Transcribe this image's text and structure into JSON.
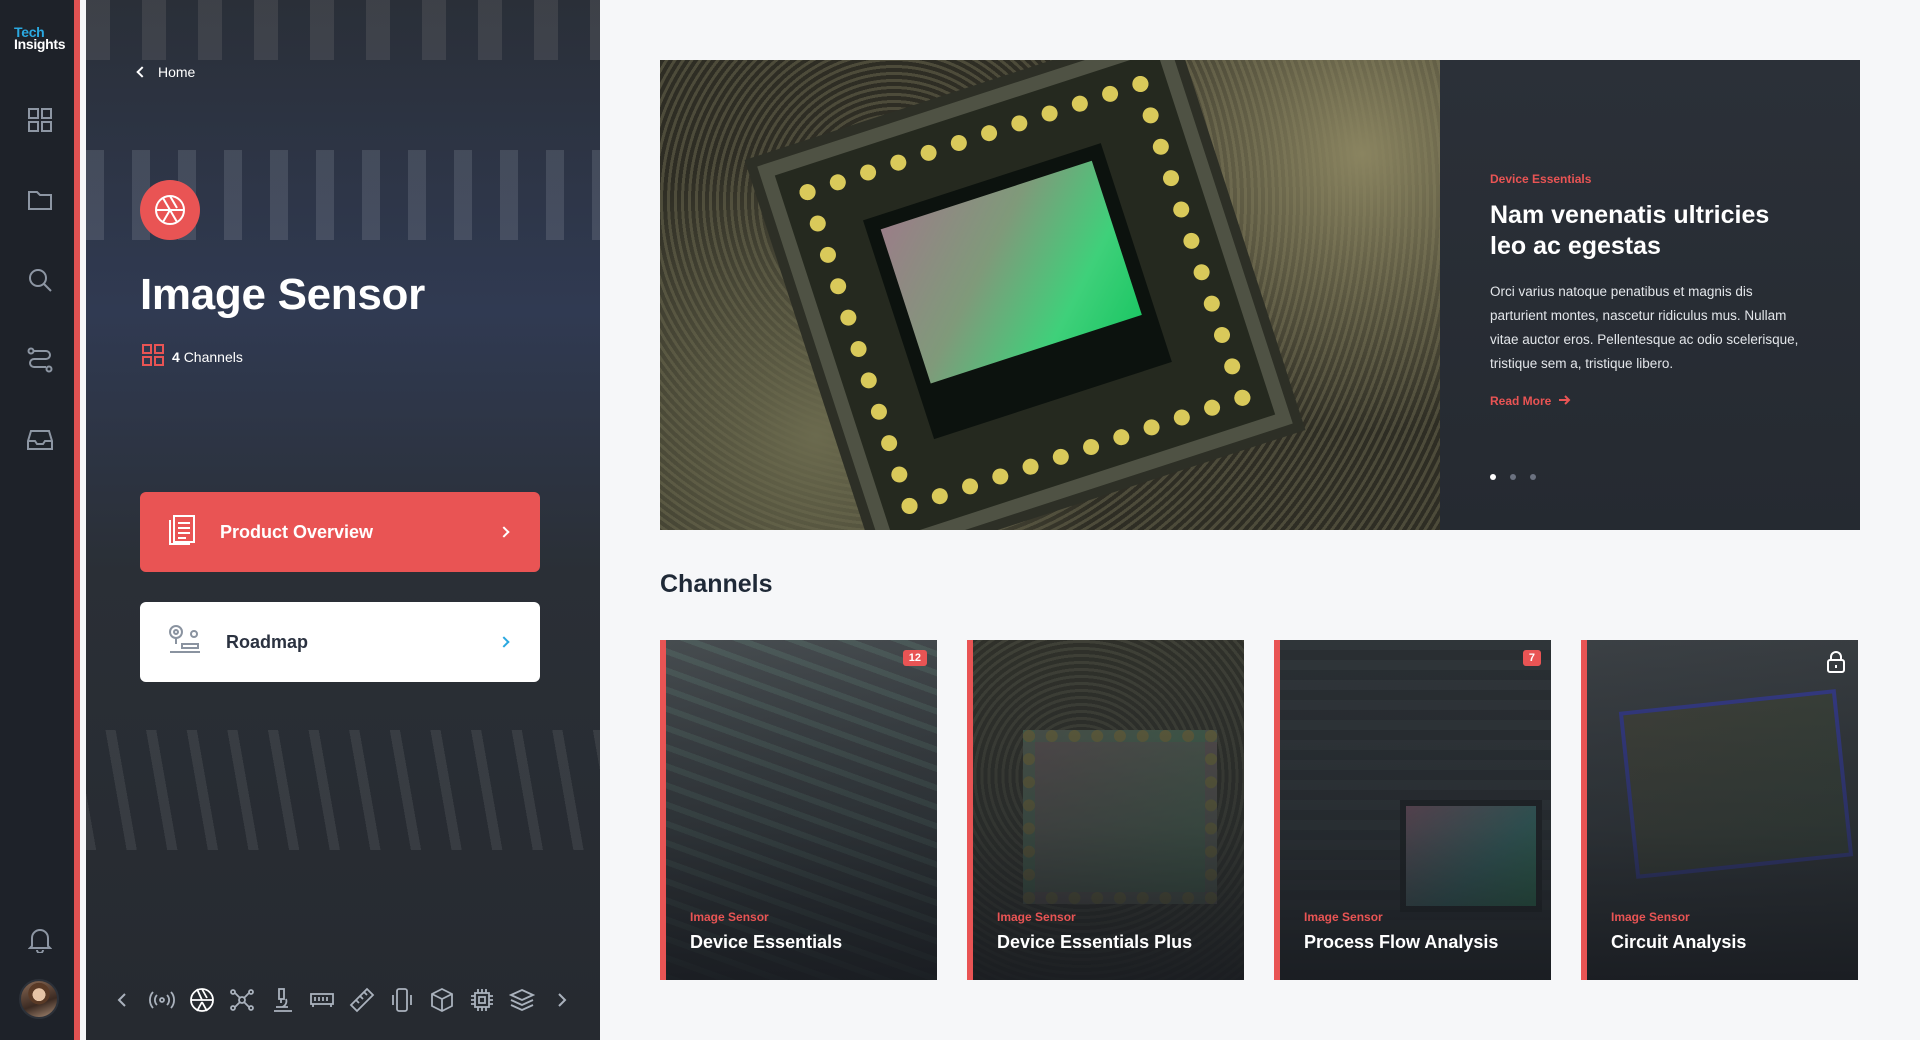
{
  "app": {
    "logo_top": "Tech",
    "logo_bottom": "Insights"
  },
  "rail": {
    "items": [
      {
        "icon": "dashboard-grid-icon"
      },
      {
        "icon": "folder-icon"
      },
      {
        "icon": "search-icon"
      },
      {
        "icon": "route-icon"
      },
      {
        "icon": "inbox-icon"
      }
    ],
    "notifications_icon": "bell-icon",
    "avatar": "user-avatar"
  },
  "panel": {
    "back_label": "Home",
    "product_icon": "aperture-icon",
    "product_title": "Image Sensor",
    "channels_count": "4",
    "channels_label": "Channels",
    "nav": [
      {
        "label": "Product Overview",
        "icon": "document-icon",
        "active": true
      },
      {
        "label": "Roadmap",
        "icon": "roadmap-icon",
        "active": false
      }
    ],
    "bottom_icons": [
      "broadcast-icon",
      "aperture-icon",
      "network-icon",
      "microscope-icon",
      "memory-icon",
      "ruler-icon",
      "phone-vibrate-icon",
      "cube-icon",
      "cpu-icon",
      "layers-icon"
    ]
  },
  "hero": {
    "eyebrow": "Device Essentials",
    "headline": "Nam venenatis ultricies leo ac egestas",
    "body": "Orci varius natoque penatibus et magnis dis parturient montes, nascetur ridiculus mus. Nullam vitae auctor eros. Pellentesque ac odio scelerisque, tristique sem a, tristique libero.",
    "cta": "Read More",
    "slide_count": 3,
    "active_slide": 1
  },
  "channels": {
    "title": "Channels",
    "items": [
      {
        "eyebrow": "Image Sensor",
        "name": "Device Essentials",
        "badge": "12",
        "locked": false
      },
      {
        "eyebrow": "Image Sensor",
        "name": "Device Essentials Plus",
        "badge": "",
        "locked": false
      },
      {
        "eyebrow": "Image Sensor",
        "name": "Process Flow Analysis",
        "badge": "7",
        "locked": false
      },
      {
        "eyebrow": "Image Sensor",
        "name": "Circuit Analysis",
        "badge": "",
        "locked": true
      }
    ]
  },
  "colors": {
    "accent": "#e95454",
    "rail": "#1e2229",
    "brand_blue": "#2aa8e0",
    "page": "#f6f7f9"
  }
}
